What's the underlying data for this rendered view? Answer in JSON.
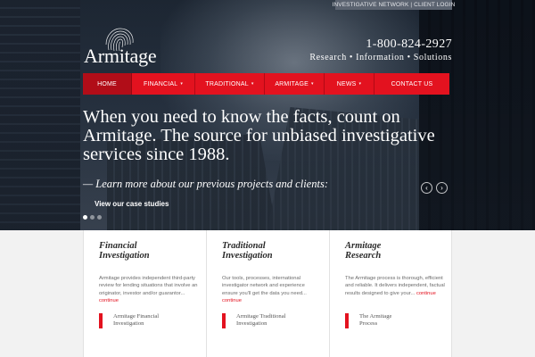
{
  "util_bar": {
    "investigative_network": "INVESTIGATIVE NETWORK",
    "separator": "|",
    "client_login": "CLIENT LOGIN"
  },
  "logo": {
    "text": "Armitage",
    "icon": "fingerprint-icon"
  },
  "contact": {
    "phone": "1-800-824-2927",
    "tagline": "Research • Information • Solutions"
  },
  "nav": {
    "items": [
      {
        "label": "HOME",
        "active": true,
        "dropdown": false
      },
      {
        "label": "FINANCIAL",
        "active": false,
        "dropdown": true
      },
      {
        "label": "TRADITIONAL",
        "active": false,
        "dropdown": true
      },
      {
        "label": "ARMITAGE",
        "active": false,
        "dropdown": true
      },
      {
        "label": "NEWS",
        "active": false,
        "dropdown": true
      },
      {
        "label": "CONTACT US",
        "active": false,
        "dropdown": false
      }
    ],
    "caret": "▾"
  },
  "hero": {
    "headline": "When you need to know the facts, count on Armitage. The source for unbiased investigative services since 1988.",
    "learn_more": "— Learn more about our previous projects and clients:",
    "case_link": "View our case studies",
    "arrows": {
      "prev": "‹",
      "next": "›"
    },
    "slide_count": 3,
    "active_slide": 1
  },
  "cards": [
    {
      "title_line1": "Financial",
      "title_line2": "Investigation",
      "body": "Armitage provides independent third-party review for lending situations that involve an originator, investor and/or guarantor...",
      "continue": "continue",
      "link_line1": "Armitage Financial",
      "link_line2": "Investigation"
    },
    {
      "title_line1": "Traditional",
      "title_line2": "Investigation",
      "body": "Our tools, processes, international investigator network and experience ensure you'll get the data you need...",
      "continue": "continue",
      "link_line1": "Armitage Traditional",
      "link_line2": "Investigation"
    },
    {
      "title_line1": "Armitage",
      "title_line2": "Research",
      "body": "The Armitage process is thorough, efficient and reliable. It delivers independent, factual results designed to give your...",
      "continue": "continue",
      "link_line1": "The Armitage",
      "link_line2": "Process"
    }
  ],
  "colors": {
    "accent": "#e3121f",
    "nav_active": "#b10d18",
    "title": "#2b2b2b",
    "body_text": "#6a6a6a"
  }
}
